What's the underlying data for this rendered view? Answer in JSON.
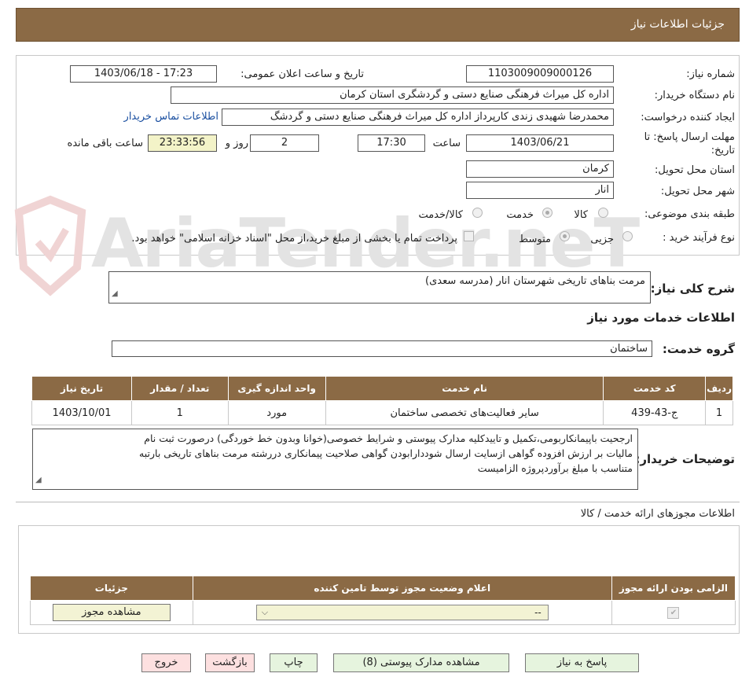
{
  "page_title": "جزئیات اطلاعات نیاز",
  "need_number": {
    "label": "شماره نیاز:",
    "value": "1103009009000126"
  },
  "announce_datetime": {
    "label": "تاریخ و ساعت اعلان عمومی:",
    "value": "1403/06/18 - 17:23"
  },
  "buyer_org": {
    "label": "نام دستگاه خریدار:",
    "value": "اداره کل میراث فرهنگی  صنایع دستی و گردشگری استان کرمان"
  },
  "requester": {
    "label": "ایجاد کننده درخواست:",
    "value": "محمدرضا شهیدی زندی کارپرداز اداره کل میراث فرهنگی  صنایع دستی و گردشگ",
    "contact_link": "اطلاعات تماس خریدار"
  },
  "deadline": {
    "label": "مهلت ارسال پاسخ: تا تاریخ:",
    "date": "1403/06/21",
    "time_label": "ساعت",
    "time": "17:30",
    "days": "2",
    "days_label": "روز و",
    "remaining": "23:33:56",
    "remaining_label": "ساعت باقی مانده"
  },
  "delivery_province": {
    "label": "استان محل تحویل:",
    "value": "کرمان"
  },
  "delivery_city": {
    "label": "شهر محل تحویل:",
    "value": "انار"
  },
  "category": {
    "label": "طبقه بندی موضوعی:",
    "options": [
      "کالا",
      "خدمت",
      "کالا/خدمت"
    ],
    "selected": "خدمت"
  },
  "purchase_type": {
    "label": "نوع فرآیند خرید :",
    "options": [
      "جزیی",
      "متوسط"
    ],
    "selected": "متوسط",
    "payment_note": "پرداخت تمام یا بخشی از مبلغ خرید،از محل \"اسناد خزانه اسلامی\" خواهد بود."
  },
  "general_desc": {
    "label": "شرح کلی نیاز:",
    "value": "مرمت بناهای تاریخی شهرستان انار (مدرسه سعدی)"
  },
  "services_section_title": "اطلاعات خدمات مورد نیاز",
  "service_group": {
    "label": "گروه خدمت:",
    "value": "ساختمان"
  },
  "services_table": {
    "headers": [
      "ردیف",
      "کد خدمت",
      "نام خدمت",
      "واحد اندازه گیری",
      "تعداد / مقدار",
      "تاریخ نیاز"
    ],
    "rows": [
      [
        "1",
        "ج-43-439",
        "سایر فعالیت‌های تخصصی ساختمان",
        "مورد",
        "1",
        "1403/10/01"
      ]
    ]
  },
  "buyer_notes": {
    "label": "توضیحات خریدار:",
    "lines": [
      "ارجحیت باپیمانکاربومی،تکمیل و تاییدکلیه مدارک پیوستی و شرایط خصوصی(خوانا وبدون خط خوردگی) درصورت ثبت نام",
      "مالیات بر ارزش افزوده گواهی ازسایت ارسال شوددارابودن گواهی صلاحیت پیمانکاری دررشته مرمت بناهای تاریخی بارتبه",
      "متناسب با مبلغ برآوردپروژه الزامیست"
    ]
  },
  "permits_title": "اطلاعات مجوزهای ارائه خدمت / کالا",
  "permits_table": {
    "headers": [
      "الزامی بودن ارائه مجوز",
      "اعلام وضعیت مجوز توسط تامین کننده",
      "جزئیات"
    ],
    "select_value": "--",
    "view_button": "مشاهده مجوز"
  },
  "buttons": {
    "reply": "پاسخ به نیاز",
    "attachments": "مشاهده مدارک پیوستی (8)",
    "print": "چاپ",
    "back": "بازگشت",
    "exit": "خروج"
  },
  "watermark": "AriaTender.neT",
  "colors": {
    "header_brown": "#8b6a45",
    "green_button": "#e6f4de",
    "red_button": "#fde0e0",
    "yellow_field": "#f3f3c8"
  }
}
